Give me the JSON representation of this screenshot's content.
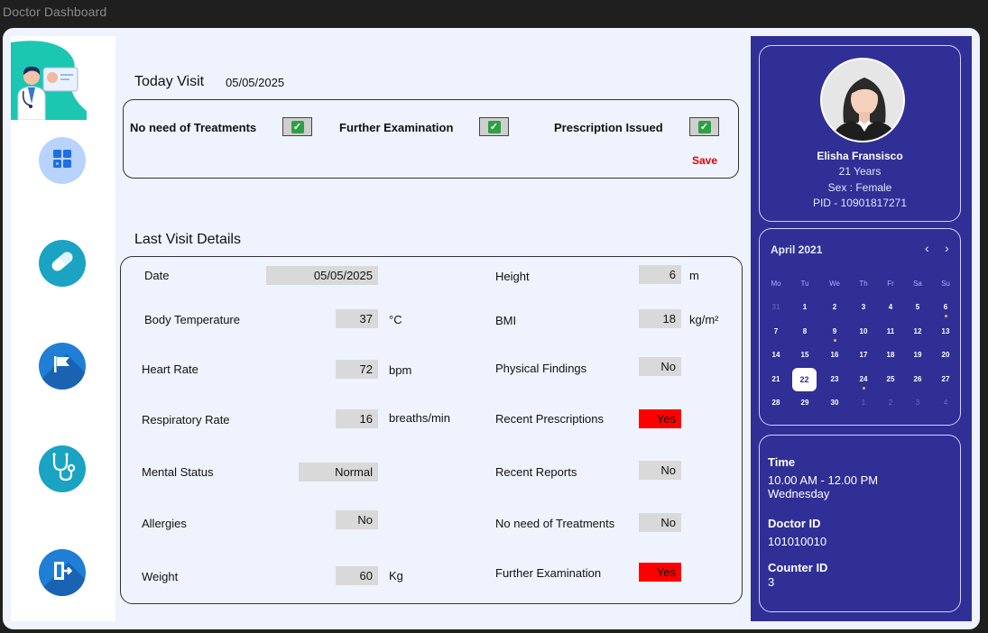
{
  "window": {
    "title": "Doctor Dashboard"
  },
  "today": {
    "heading": "Today Visit",
    "date": "05/05/2025",
    "checks": [
      {
        "label": "No need of Treatments",
        "checked": true
      },
      {
        "label": "Further Examination",
        "checked": true
      },
      {
        "label": "Prescription Issued",
        "checked": true
      }
    ],
    "save_label": "Save"
  },
  "last_visit": {
    "heading": "Last Visit Details",
    "left": [
      {
        "label": "Date",
        "value": "05/05/2025",
        "unit": ""
      },
      {
        "label": "Body Temperature",
        "value": "37",
        "unit": "°C"
      },
      {
        "label": "Heart Rate",
        "value": "72",
        "unit": "bpm"
      },
      {
        "label": "Respiratory Rate",
        "value": "16",
        "unit": "breaths/min"
      },
      {
        "label": "Mental Status",
        "value": "Normal",
        "unit": ""
      },
      {
        "label": "Allergies",
        "value": "No",
        "unit": ""
      },
      {
        "label": "Weight",
        "value": "60",
        "unit": "Kg"
      }
    ],
    "right": [
      {
        "label": "Height",
        "value": "6",
        "unit": "m",
        "alert": false
      },
      {
        "label": "BMI",
        "value": "18",
        "unit": "kg/m²",
        "alert": false
      },
      {
        "label": "Physical Findings",
        "value": "No",
        "unit": "",
        "alert": false
      },
      {
        "label": "Recent Prescriptions",
        "value": "Yes",
        "unit": "",
        "alert": true
      },
      {
        "label": "Recent Reports",
        "value": "No",
        "unit": "",
        "alert": false
      },
      {
        "label": "No need of Treatments",
        "value": "No",
        "unit": "",
        "alert": false
      },
      {
        "label": "Further Examination",
        "value": "Yes",
        "unit": "",
        "alert": true
      }
    ]
  },
  "sidebar": {
    "items": [
      {
        "icon": "dashboard-icon",
        "color": "#b9d3ff"
      },
      {
        "icon": "pill-icon",
        "color": "#1aa3c2"
      },
      {
        "icon": "flag-icon",
        "color": "#1f7fd6"
      },
      {
        "icon": "stethoscope-icon",
        "color": "#1aa3c2"
      },
      {
        "icon": "logout-icon",
        "color": "#1f7fd6"
      }
    ]
  },
  "patient": {
    "name": "Elisha Fransisco",
    "age": "21 Years",
    "sex": "Sex : Female",
    "pid": "PID - 10901817271"
  },
  "calendar": {
    "month": "April 2021",
    "weekdays": [
      "Mo",
      "Tu",
      "We",
      "Th",
      "Fr",
      "Sa",
      "Su"
    ],
    "weeks": [
      [
        "31",
        "1",
        "2",
        "3",
        "4",
        "5",
        "6"
      ],
      [
        "7",
        "8",
        "9",
        "10",
        "11",
        "12",
        "13"
      ],
      [
        "14",
        "15",
        "16",
        "17",
        "18",
        "19",
        "20"
      ],
      [
        "21",
        "22",
        "23",
        "24",
        "25",
        "26",
        "27"
      ],
      [
        "28",
        "29",
        "30",
        "1",
        "2",
        "3",
        "4"
      ]
    ],
    "selected": "22"
  },
  "appointment": {
    "time_label": "Time",
    "time_value": "10.00 AM - 12.00 PM",
    "day": "Wednesday",
    "doctor_label": "Doctor ID",
    "doctor_value": "101010010",
    "counter_label": "Counter ID",
    "counter_value": "3"
  },
  "colors": {
    "accent": "#2f2f96",
    "alert": "#ff0000",
    "save": "#e00000"
  }
}
